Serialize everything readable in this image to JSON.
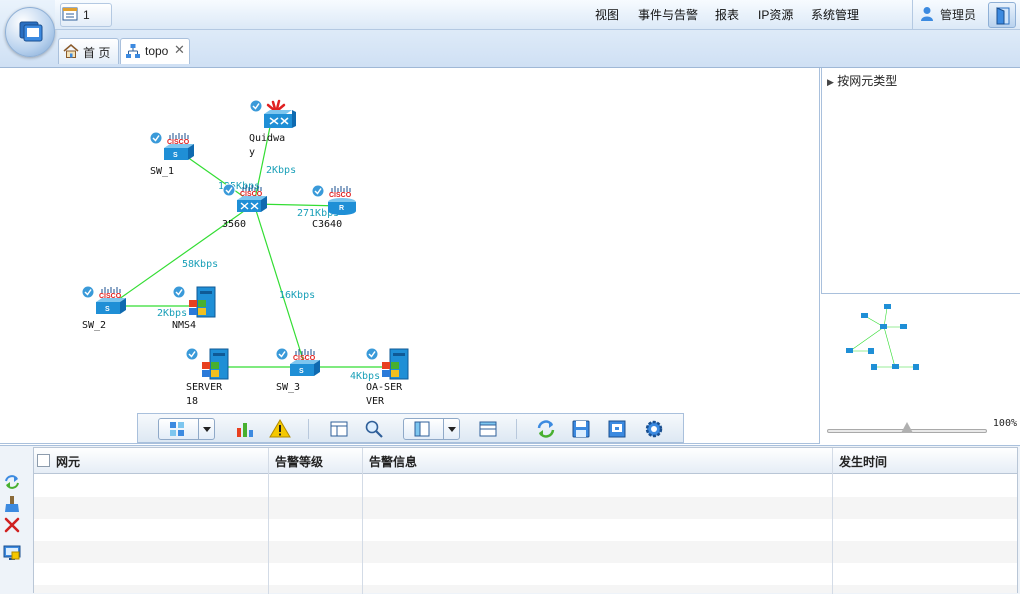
{
  "header": {
    "message_count": "1",
    "nav": [
      "视图",
      "事件与告警",
      "报表",
      "IP资源",
      "系统管理"
    ],
    "user": "管理员"
  },
  "tabs": [
    {
      "label": "首 页"
    },
    {
      "label": "topo"
    }
  ],
  "topology": {
    "nodes": [
      {
        "label": "Quidwa\ny",
        "type": "huawei-switch"
      },
      {
        "label": "SW_1",
        "type": "cisco-switch"
      },
      {
        "label": "3560",
        "type": "cisco-switch-l3"
      },
      {
        "label": "C3640",
        "type": "cisco-router"
      },
      {
        "label": "SW_2",
        "type": "cisco-switch"
      },
      {
        "label": "NMS4",
        "type": "windows-server"
      },
      {
        "label": "SERVER\n18",
        "type": "windows-server"
      },
      {
        "label": "SW_3",
        "type": "cisco-switch"
      },
      {
        "label": "OA-SER\nVER",
        "type": "windows-server"
      }
    ],
    "links": [
      {
        "label": "2Kbps"
      },
      {
        "label": "125Kbps"
      },
      {
        "label": "271Kbps"
      },
      {
        "label": "58Kbps"
      },
      {
        "label": "16Kbps"
      },
      {
        "label": "2Kbps"
      },
      {
        "label": "4Kbps"
      }
    ]
  },
  "right_panel": {
    "tree_root": "按网元类型",
    "zoom": "100%",
    "zoom_level": 0.5
  },
  "alarm_table": {
    "columns": [
      "网元",
      "告警等级",
      "告警信息",
      "发生时间"
    ],
    "rows": []
  },
  "colors": {
    "link": "#33dd33",
    "link_label": "#1aa0b8",
    "header_bg": "#cfe0f4"
  }
}
